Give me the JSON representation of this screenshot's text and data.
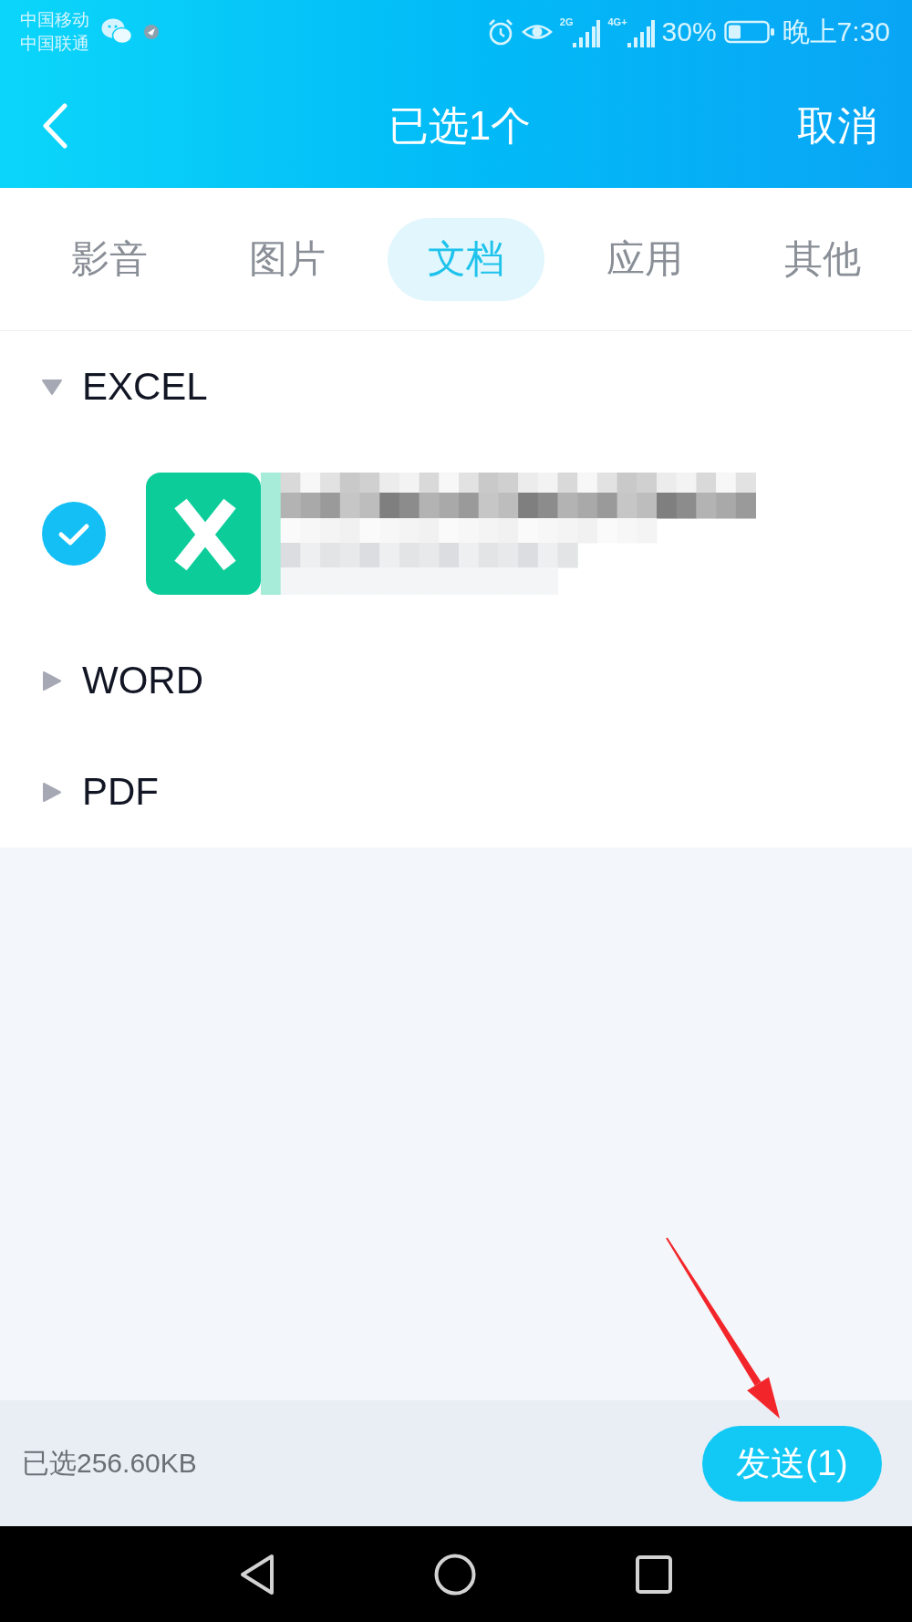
{
  "status_bar": {
    "carriers": [
      "中国移动",
      "中国联通"
    ],
    "signals": [
      {
        "label": "2G"
      },
      {
        "label": "4G+"
      }
    ],
    "battery": "30%",
    "time": "晚上7:30"
  },
  "header": {
    "title": "已选1个",
    "cancel": "取消"
  },
  "tabs": [
    {
      "label": "影音",
      "selected": false
    },
    {
      "label": "图片",
      "selected": false
    },
    {
      "label": "文档",
      "selected": true
    },
    {
      "label": "应用",
      "selected": false
    },
    {
      "label": "其他",
      "selected": false
    }
  ],
  "groups": [
    {
      "name": "EXCEL",
      "expanded": true,
      "files": [
        {
          "kind": "excel",
          "checked": true
        }
      ]
    },
    {
      "name": "WORD",
      "expanded": false
    },
    {
      "name": "PDF",
      "expanded": false
    }
  ],
  "footer": {
    "selected_size": "已选256.60KB",
    "send_button": "发送(1)"
  },
  "annotation": {
    "kind": "arrow"
  }
}
